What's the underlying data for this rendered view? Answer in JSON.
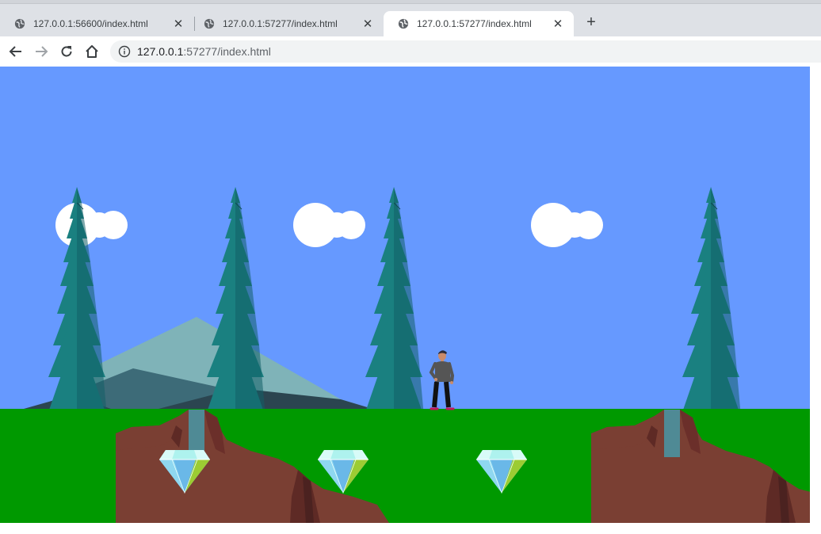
{
  "browser": {
    "tabs": [
      {
        "title": "127.0.0.1:56600/index.html",
        "active": false
      },
      {
        "title": "127.0.0.1:57277/index.html",
        "active": false
      },
      {
        "title": "127.0.0.1:57277/index.html",
        "active": true
      }
    ],
    "new_tab_label": "+",
    "close_glyph": "✕",
    "address": {
      "host": "127.0.0.1",
      "rest": ":57277/index.html"
    }
  },
  "game": {
    "colors": {
      "sky": "#6699ff",
      "grass": "#009900",
      "cloud": "#ffffff",
      "tree": "#1a8080",
      "mountain_far": "#7fb3b8",
      "mountain_mid": "#3d6b78",
      "mountain_near": "#2b4550",
      "canyon": "#7a3f33",
      "water": "#4f8a95",
      "gem_top": "#aef2ee",
      "gem_left": "#6ab8e8",
      "gem_right": "#9ccc33"
    },
    "clouds": 3,
    "trees": 4,
    "collectables": 3,
    "canyons": 2,
    "player": "standing"
  }
}
